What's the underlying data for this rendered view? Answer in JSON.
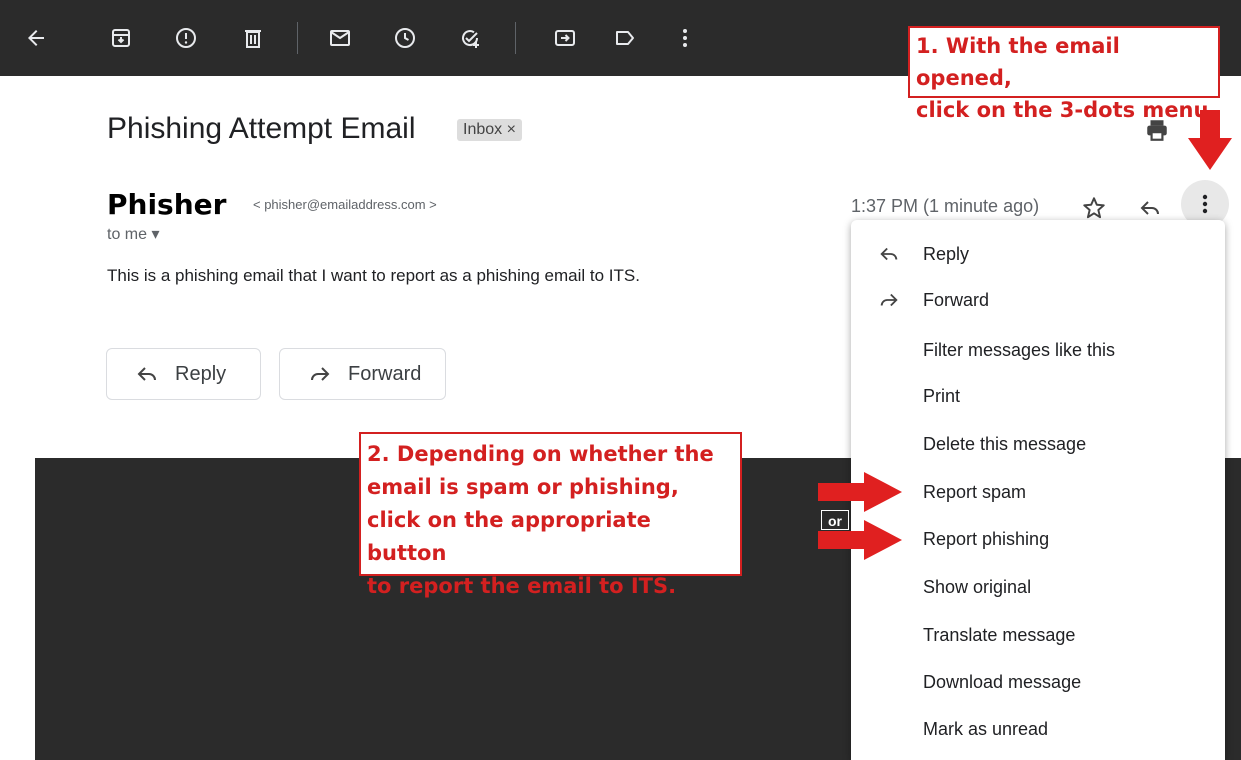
{
  "toolbar": {
    "icons": [
      "back-arrow-icon",
      "archive-icon",
      "report-spam-icon",
      "delete-icon",
      "mark-unread-icon",
      "snooze-icon",
      "add-to-tasks-icon",
      "move-to-icon",
      "labels-icon",
      "more-vert-icon"
    ]
  },
  "annotations": {
    "step1_line1": "1. With the email opened,",
    "step1_line2": "click on the 3-dots menu",
    "step2_line1": "2. Depending on whether the",
    "step2_line2": "email is spam or phishing,",
    "step2_line3": "click on the appropriate button",
    "step2_line4": "to report the email to ITS.",
    "or_label": "or",
    "accent_color": "#d32020"
  },
  "email": {
    "subject": "Phishing Attempt Email",
    "label_chip": "Inbox ×",
    "sender_name": "Phisher",
    "sender_email": "< phisher@emailaddress.com >",
    "recipient": "to me ▾",
    "timestamp": "1:37 PM (1 minute ago)",
    "body": "This is a phishing email that I want to report as a phishing email to ITS."
  },
  "actions": {
    "reply_label": "Reply",
    "forward_label": "Forward"
  },
  "menu": {
    "items": [
      {
        "label": "Reply",
        "icon": "reply-icon"
      },
      {
        "label": "Forward",
        "icon": "forward-icon"
      },
      {
        "label": "Filter messages like this",
        "icon": ""
      },
      {
        "label": "Print",
        "icon": ""
      },
      {
        "label": "Delete this message",
        "icon": ""
      },
      {
        "label": "Report spam",
        "icon": ""
      },
      {
        "label": "Report phishing",
        "icon": ""
      },
      {
        "label": "Show original",
        "icon": ""
      },
      {
        "label": "Translate message",
        "icon": ""
      },
      {
        "label": "Download message",
        "icon": ""
      },
      {
        "label": "Mark as unread",
        "icon": ""
      }
    ]
  }
}
